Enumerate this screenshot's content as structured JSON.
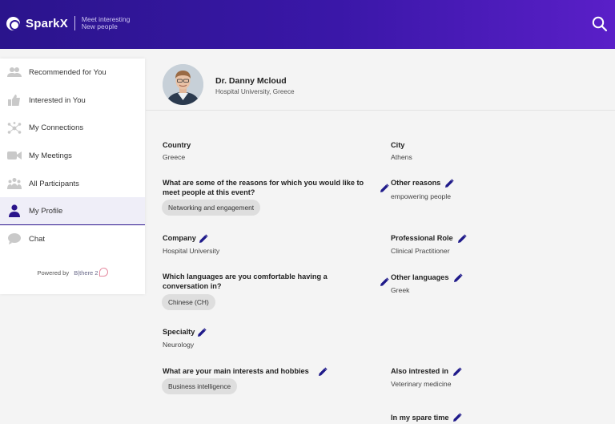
{
  "header": {
    "brand": "SparkX",
    "tagline_line1": "Meet interesting",
    "tagline_line2": "New people",
    "search_icon": "search-icon"
  },
  "sidebar": {
    "items": [
      {
        "label": "Recommended for You",
        "icon": "people-icon"
      },
      {
        "label": "Interested in You",
        "icon": "thumbs-up-icon"
      },
      {
        "label": "My Connections",
        "icon": "network-icon"
      },
      {
        "label": "My Meetings",
        "icon": "video-camera-icon"
      },
      {
        "label": "All Participants",
        "icon": "group-icon"
      },
      {
        "label": "My Profile",
        "icon": "person-icon"
      },
      {
        "label": "Chat",
        "icon": "chat-bubble-icon"
      }
    ],
    "active_index": 5,
    "powered_by": "Powered by",
    "powered_brand": "B|there 2"
  },
  "profile": {
    "name": "Dr. Danny Mcloud",
    "affiliation": "Hospital University, Greece",
    "fields": {
      "country_label": "Country",
      "country_value": "Greece",
      "city_label": "City",
      "city_value": "Athens",
      "reasons_label_1": "What are some of the reasons for which you would like to",
      "reasons_label_2": "meet people at this event?",
      "reasons_chip": "Networking and engagement",
      "other_reasons_label": "Other reasons",
      "other_reasons_value": "empowering people",
      "company_label": "Company",
      "company_value": "Hospital University",
      "role_label": "Professional Role",
      "role_value": "Clinical Practitioner",
      "languages_label_1": "Which languages are you comfortable having a",
      "languages_label_2": "conversation in?",
      "languages_chip": "Chinese (CH)",
      "other_languages_label": "Other languages",
      "other_languages_value": "Greek",
      "specialty_label": "Specialty",
      "specialty_value": "Neurology",
      "interests_label": "What are your main interests and hobbies",
      "interests_chip": "Business intelligence",
      "also_label": "Also intrested in",
      "also_value": "Veterinary medicine",
      "spare_label": "In my spare time"
    }
  },
  "colors": {
    "header_start": "#2a148c",
    "header_end": "#5a1fc8",
    "accent": "#2a148c",
    "edit_icon": "#1f1a8a"
  }
}
